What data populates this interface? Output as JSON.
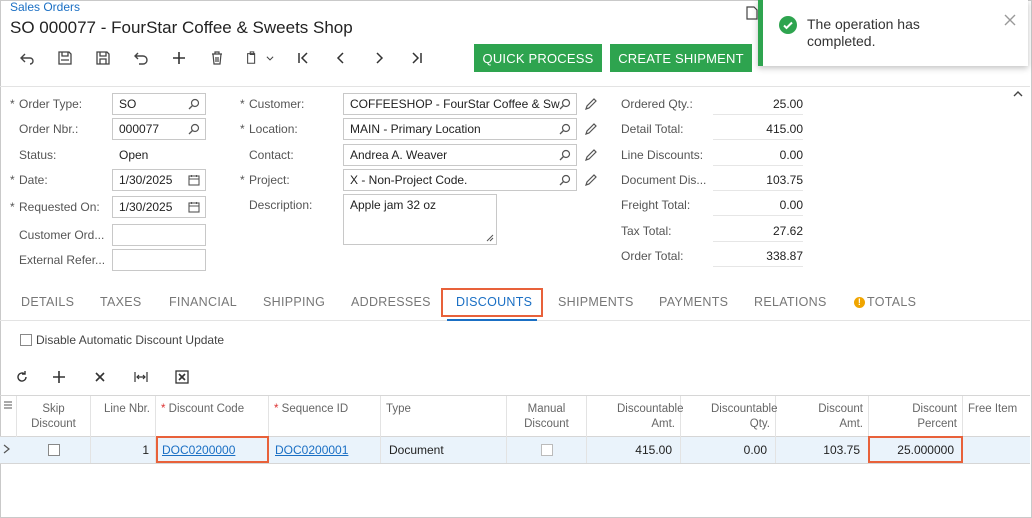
{
  "breadcrumb": "Sales Orders",
  "title": "SO 000077 - FourStar Coffee & Sweets Shop",
  "buttons": {
    "quick_process": "QUICK PROCESS",
    "create_shipment": "CREATE SHIPMENT"
  },
  "toast": {
    "message": "The operation has completed."
  },
  "form": {
    "order_type": {
      "label": "Order Type:",
      "value": "SO"
    },
    "order_nbr": {
      "label": "Order Nbr.:",
      "value": "000077"
    },
    "status": {
      "label": "Status:",
      "value": "Open"
    },
    "date": {
      "label": "Date:",
      "value": "1/30/2025"
    },
    "requested_on": {
      "label": "Requested On:",
      "value": "1/30/2025"
    },
    "customer_ord": {
      "label": "Customer Ord...",
      "value": ""
    },
    "external_refer": {
      "label": "External Refer...",
      "value": ""
    },
    "customer": {
      "label": "Customer:",
      "value": "COFFEESHOP - FourStar Coffee & Sw"
    },
    "location": {
      "label": "Location:",
      "value": "MAIN - Primary Location"
    },
    "contact": {
      "label": "Contact:",
      "value": "Andrea A. Weaver"
    },
    "project": {
      "label": "Project:",
      "value": "X - Non-Project Code."
    },
    "description": {
      "label": "Description:",
      "value": "Apple jam 32 oz"
    }
  },
  "totals": [
    {
      "label": "Ordered Qty.:",
      "value": "25.00"
    },
    {
      "label": "Detail Total:",
      "value": "415.00"
    },
    {
      "label": "Line Discounts:",
      "value": "0.00"
    },
    {
      "label": "Document Dis...",
      "value": "103.75"
    },
    {
      "label": "Freight Total:",
      "value": "0.00"
    },
    {
      "label": "Tax Total:",
      "value": "27.62"
    },
    {
      "label": "Order Total:",
      "value": "338.87"
    }
  ],
  "tabs": [
    "DETAILS",
    "TAXES",
    "FINANCIAL",
    "SHIPPING",
    "ADDRESSES",
    "DISCOUNTS",
    "SHIPMENTS",
    "PAYMENTS",
    "RELATIONS",
    "TOTALS"
  ],
  "active_tab": "DISCOUNTS",
  "disable_discount_label": "Disable Automatic Discount Update",
  "grid": {
    "headers": {
      "skip_discount": "Skip Discount",
      "line_nbr": "Line Nbr.",
      "discount_code": "Discount Code",
      "sequence_id": "Sequence ID",
      "type": "Type",
      "manual_discount": "Manual Discount",
      "discountable_amt": "Discountable Amt.",
      "discountable_qty": "Discountable Qty.",
      "discount_amt": "Discount Amt.",
      "discount_percent": "Discount Percent",
      "free_item": "Free Item"
    },
    "rows": [
      {
        "line_nbr": "1",
        "discount_code": "DOC0200000",
        "sequence_id": "DOC0200001",
        "type": "Document",
        "discountable_amt": "415.00",
        "discountable_qty": "0.00",
        "discount_amt": "103.75",
        "discount_percent": "25.000000",
        "free_item": ""
      }
    ]
  },
  "colors": {
    "accent": "#1a6fc4",
    "green": "#2ea44f",
    "highlight": "#e8613a",
    "row_selected": "#eaf3fb"
  }
}
